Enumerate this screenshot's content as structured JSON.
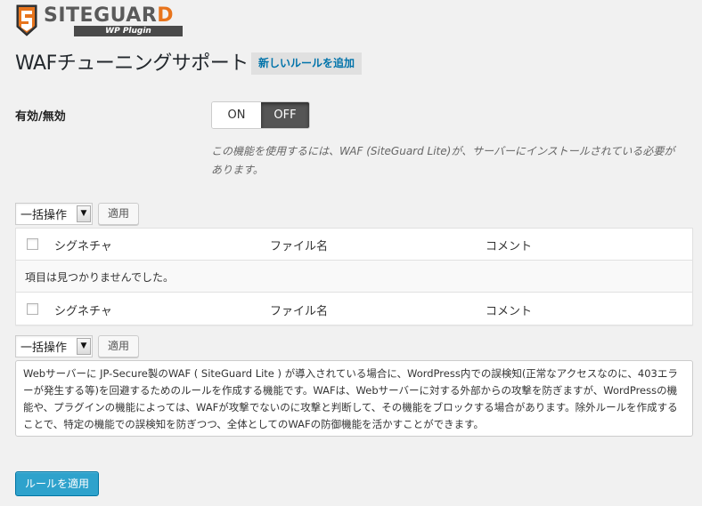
{
  "branding": {
    "logo_name_main": "SITEGUAR",
    "logo_name_end": "D",
    "logo_subtitle": "WP Plugin",
    "accent_color": "#e8741c"
  },
  "header": {
    "title": "WAFチューニングサポート",
    "add_new_label": "新しいルールを追加"
  },
  "settings": {
    "enable_label": "有効/無効",
    "toggle_on": "ON",
    "toggle_off": "OFF",
    "toggle_state": "OFF",
    "notice": "この機能を使用するには、WAF (SiteGuard Lite)が、サーバーにインストールされている必要があります。"
  },
  "bulk_actions": {
    "select_value": "一括操作",
    "apply_label": "適用"
  },
  "table": {
    "columns": [
      "シグネチャ",
      "ファイル名",
      "コメント"
    ],
    "empty_message": "項目は見つかりませんでした。"
  },
  "description": "Webサーバーに JP-Secure製のWAF ( SiteGuard Lite ) が導入されている場合に、WordPress内での誤検知(正常なアクセスなのに、403エラーが発生する等)を回避するためのルールを作成する機能です。WAFは、Webサーバーに対する外部からの攻撃を防ぎますが、WordPressの機能や、プラグインの機能によっては、WAFが攻撃でないのに攻撃と判断して、その機能をブロックする場合があります。除外ルールを作成することで、特定の機能での誤検知を防ぎつつ、全体としてのWAFの防御機能を活かすことができます。",
  "submit_label": "ルールを適用",
  "colors": {
    "primary_button": "#2ea2cc",
    "link": "#0073aa",
    "toggle_active": "#555555"
  }
}
